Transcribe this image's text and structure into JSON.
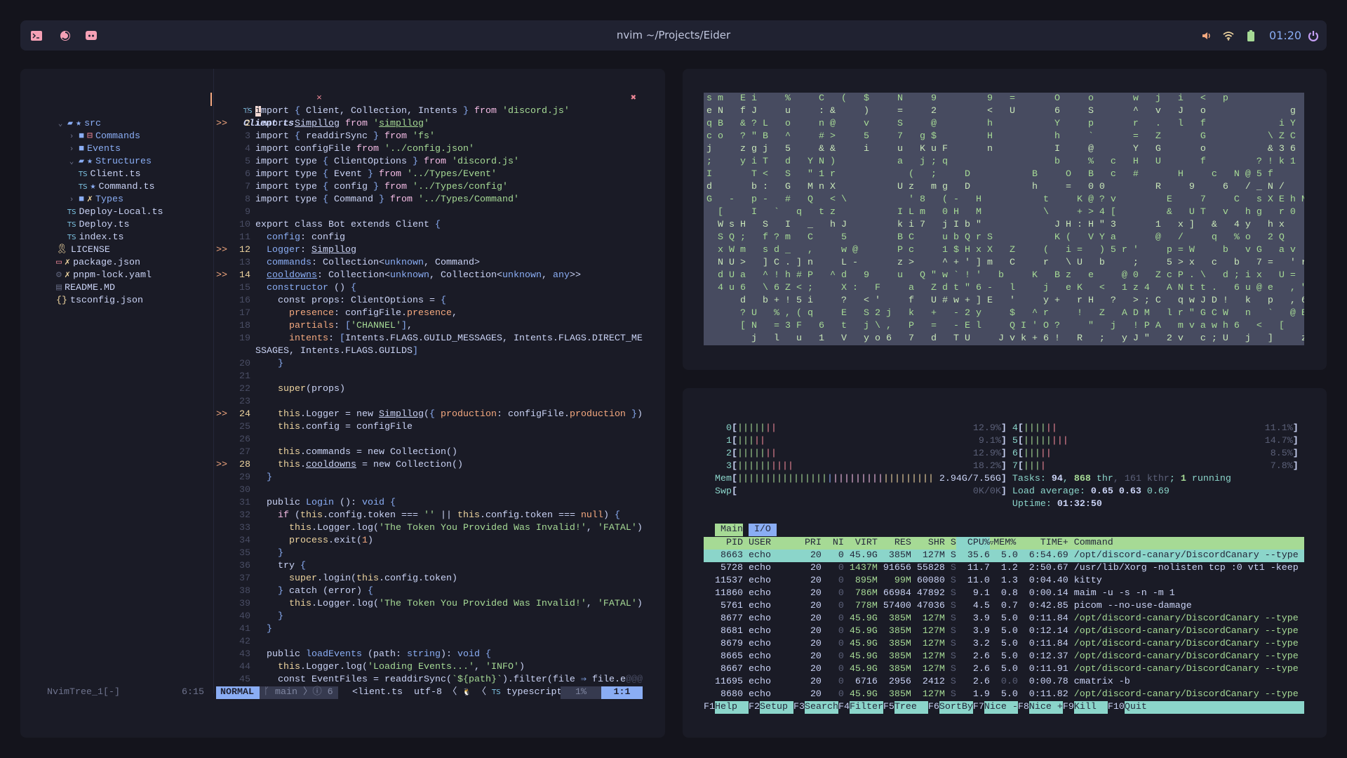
{
  "topbar": {
    "title": "nvim ~/Projects/Eider",
    "clock": "01:20",
    "left_icons": [
      "terminal-icon",
      "firefox-icon",
      "discord-icon"
    ],
    "right_icons": [
      "volume-icon",
      "wifi-icon",
      "battery-icon",
      "power-icon"
    ],
    "colors": {
      "accent": "#f5a0b5",
      "clock": "#8aadf4",
      "volume": "#f5a97f",
      "wifi": "#eed49f",
      "battery": "#a6da95",
      "power": "#c6a0f6"
    }
  },
  "nvim": {
    "tab": {
      "type_label": "TS",
      "filename": "Client.ts",
      "close": "×",
      "close_all": "✖"
    },
    "tree": [
      {
        "name": "src",
        "depth": 0,
        "kind": "dir",
        "open": true,
        "badge": "★"
      },
      {
        "name": "Commands",
        "depth": 1,
        "kind": "dir",
        "open": false,
        "badge": "⊟"
      },
      {
        "name": "Events",
        "depth": 1,
        "kind": "dir",
        "open": false,
        "badge": ""
      },
      {
        "name": "Structures",
        "depth": 1,
        "kind": "dir",
        "open": true,
        "badge": "★"
      },
      {
        "name": "Client.ts",
        "depth": 2,
        "kind": "ts",
        "badge": ""
      },
      {
        "name": "Command.ts",
        "depth": 2,
        "kind": "ts",
        "badge": "★"
      },
      {
        "name": "Types",
        "depth": 1,
        "kind": "dir",
        "open": false,
        "badge": "✗"
      },
      {
        "name": "Deploy-Local.ts",
        "depth": 1,
        "kind": "ts",
        "badge": ""
      },
      {
        "name": "Deploy.ts",
        "depth": 1,
        "kind": "ts",
        "badge": ""
      },
      {
        "name": "index.ts",
        "depth": 1,
        "kind": "ts",
        "badge": ""
      },
      {
        "name": "LICENSE",
        "depth": 0,
        "kind": "license",
        "badge": ""
      },
      {
        "name": "package.json",
        "depth": 0,
        "kind": "package",
        "badge": "✗"
      },
      {
        "name": "pnpm-lock.yaml",
        "depth": 0,
        "kind": "gear",
        "badge": "✗"
      },
      {
        "name": "README.MD",
        "depth": 0,
        "kind": "readme",
        "badge": ""
      },
      {
        "name": "tsconfig.json",
        "depth": 0,
        "kind": "json",
        "badge": ""
      }
    ],
    "sign_text": ">>",
    "signs": [
      2,
      12,
      14,
      24,
      28
    ],
    "code": [
      "import { Client, Collection, Intents } from 'discord.js'",
      "import Simpllog from 'simpllog'",
      "import { readdirSync } from 'fs'",
      "import configFile from '../config.json'",
      "import type { ClientOptions } from 'discord.js'",
      "import type { Event } from '../Types/Event'",
      "import type { config } from '../Types/config'",
      "import type { Command } from '../Types/Command'",
      "",
      "export class Bot extends Client {",
      "  config: config",
      "  Logger: Simpllog",
      "  commands: Collection<unknown, Command>",
      "  cooldowns: Collection<unknown, Collection<unknown, any>>",
      "  constructor () {",
      "    const props: ClientOptions = {",
      "      presence: configFile.presence,",
      "      partials: ['CHANNEL'],",
      "      intents: [Intents.FLAGS.GUILD_MESSAGES, Intents.FLAGS.DIRECT_MESSAGES, Intents.FLAGS.GUILDS]",
      "    }",
      "",
      "    super(props)",
      "",
      "    this.Logger = new Simpllog({ production: configFile.production })",
      "    this.config = configFile",
      "",
      "    this.commands = new Collection()",
      "    this.cooldowns = new Collection()",
      "  }",
      "",
      "  public Login (): void {",
      "    if (this.config.token === '' || this.config.token === null) {",
      "      this.Logger.log('The Token You Provided Was Invalid!', 'FATAL')",
      "      process.exit(1)",
      "    }",
      "    try {",
      "      super.login(this.config.token)",
      "    } catch (error) {",
      "      this.Logger.log('The Token You Provided Was Invalid!', 'FATAL')",
      "    }",
      "  }",
      "",
      "  public loadEvents (path: string): void {",
      "    this.Logger.log('Loading Events...', 'INFO')",
      "    const EventFiles = readdirSync(`${path}`).filter(file ⇒ file.e@@@"
    ],
    "statusline": {
      "tree_name": "NvimTree_1[-]",
      "tree_pos": "6:15",
      "mode": "NORMAL",
      "branch": "main",
      "diagnostics": "ⓘ 6",
      "filename": "<lient.ts",
      "encoding": "utf-8",
      "os_icon": "🐧",
      "filetype_icon": "TS",
      "filetype": "typescript",
      "percent": "1%",
      "position": "1:1"
    }
  },
  "matrix": {
    "rows": [
      "sm Ei  %  C ( $  N  9    9 =   O  o   w j i < p",
      "eN fJ  u  :&  )  =  2    < U   6  S   ^ v J o       g",
      "qB &?L o  n@  v  S  @    h     Y  p   r . l f      iY",
      "co ?\"B ^  #>  5  7 g$    H     h  `   = Z   G     \\ZC",
      "j  zgj 5  &&  i  u KuF   n     I  @   Y G   o     &36",
      ";  yiT d YN)     a j;q         b  % c H U   f    ?!k1",
      "I   T< S \"1r      ( ;  D     B  O B c #   H  c N@5f",
      "d   b: G MnX     Uz mg D     h  = 00    R  9  6 /_N/",
      "G - p- # Q <\\     '8 (- H     t  K@?v    E  7  C sXEhN",
      " [  I ` q tz     ILm 0H M     \\  +>4[    & UT v hg r0",
      " WsH S I _ hJ    ki7 jIb\"      JH:H\"3   1 x] & 4y hx",
      " SQ; f?m C  5    BC  ubQrS     K( VYa   @ /  q %o 2Q",
      " xWm sd_ ,  w@   Pc  1$HxX Z  ( i= )5r'  p=W  b vG av",
      " NU> ]C.]n  L-   z>  ^+']m C  r \\U b  ;  5>x c b 7= 'r",
      " dUa ^!h#P ^d 9  u Q\"w`!' b  K Bz e  @0 ZcP.\\ d;ix U=",
      " 4u6 \\6Z<;  X: F  a Zdt\"6- l  j eK < 1z4 ANtt. 6u@e ,\"",
      "   d b+!5i  ? <'  f U#w+]E '  y+ rH ? >;C qwJD! k p ,6",
      "   ?U %,(q  E S2j k + -2y  $ ^r  ! Z ADM lr\"GCW n ` @E",
      "   [N =3F 6 t j\\, P = -El  QI'O?  \" j !PA mvawh6 < [  C",
      "    j l u 1 V yo6 7 d TU  Jvk+6! R ; yJ\" 2v c;U j ]  z"
    ]
  },
  "htop": {
    "cpus": [
      {
        "id": "0",
        "pct": "12.9%"
      },
      {
        "id": "1",
        "pct": "9.1%"
      },
      {
        "id": "2",
        "pct": "12.9%"
      },
      {
        "id": "3",
        "pct": "18.2%"
      },
      {
        "id": "4",
        "pct": "11.1%"
      },
      {
        "id": "5",
        "pct": "14.7%"
      },
      {
        "id": "6",
        "pct": "8.5%"
      },
      {
        "id": "7",
        "pct": "7.8%"
      }
    ],
    "mem": {
      "label": "Mem",
      "value": "2.94G/7.56G"
    },
    "swap": {
      "label": "Swp",
      "value": "0K/0K"
    },
    "tasks": {
      "label": "Tasks: ",
      "tasks": "94",
      "threads": "868",
      "thr_label": " thr",
      "kthreads": "161 kthr",
      "running": "1",
      "running_label": " running"
    },
    "load": {
      "label": "Load average: ",
      "values": [
        "0.65",
        "0.63",
        "0.69"
      ]
    },
    "uptime": {
      "label": "Uptime: ",
      "value": "01:32:50"
    },
    "tabs": [
      "Main",
      "I/O"
    ],
    "columns": {
      "pid": "PID",
      "user": "USER",
      "pri": "PRI",
      "ni": "NI",
      "virt": "VIRT",
      "res": "RES",
      "shr": "SHR",
      "s": "S",
      "cpu": "CPU%",
      "sort": "▽",
      "mem": "MEM%",
      "time": "TIME+",
      "cmd": "Command"
    },
    "processes": [
      {
        "pid": "8663",
        "user": "echo",
        "pri": "20",
        "ni": "0",
        "virt": "45.9G",
        "res": "385M",
        "shr": "127M",
        "s": "S",
        "cpu": "35.6",
        "mem": "5.0",
        "time": "6:54.69",
        "cmd": "/opt/discord-canary/DiscordCanary --type",
        "selected": true
      },
      {
        "pid": "5728",
        "user": "echo",
        "pri": "20",
        "ni": "0",
        "virt": "1437M",
        "res": "91656",
        "shr": "55828",
        "s": "S",
        "cpu": "11.7",
        "mem": "1.2",
        "time": "2:50.67",
        "cmd": "/usr/lib/Xorg -nolisten tcp :0 vt1 -keep"
      },
      {
        "pid": "11537",
        "user": "echo",
        "pri": "20",
        "ni": "0",
        "virt": "895M",
        "res": "99M",
        "shr": "60080",
        "s": "S",
        "cpu": "11.0",
        "mem": "1.3",
        "time": "0:04.40",
        "cmd": "kitty"
      },
      {
        "pid": "11860",
        "user": "echo",
        "pri": "20",
        "ni": "0",
        "virt": "786M",
        "res": "66984",
        "shr": "47892",
        "s": "S",
        "cpu": "9.1",
        "mem": "0.8",
        "time": "0:00.14",
        "cmd": "maim -u -s -n -m 1"
      },
      {
        "pid": "5761",
        "user": "echo",
        "pri": "20",
        "ni": "0",
        "virt": "778M",
        "res": "57400",
        "shr": "47036",
        "s": "S",
        "cpu": "4.5",
        "mem": "0.7",
        "time": "0:42.85",
        "cmd": "picom --no-use-damage"
      },
      {
        "pid": "8677",
        "user": "echo",
        "pri": "20",
        "ni": "0",
        "virt": "45.9G",
        "res": "385M",
        "shr": "127M",
        "s": "S",
        "cpu": "3.9",
        "mem": "5.0",
        "time": "0:11.84",
        "cmd": "/opt/discord-canary/DiscordCanary --type",
        "thread": true
      },
      {
        "pid": "8681",
        "user": "echo",
        "pri": "20",
        "ni": "0",
        "virt": "45.9G",
        "res": "385M",
        "shr": "127M",
        "s": "S",
        "cpu": "3.9",
        "mem": "5.0",
        "time": "0:12.14",
        "cmd": "/opt/discord-canary/DiscordCanary --type",
        "thread": true
      },
      {
        "pid": "8679",
        "user": "echo",
        "pri": "20",
        "ni": "0",
        "virt": "45.9G",
        "res": "385M",
        "shr": "127M",
        "s": "S",
        "cpu": "3.2",
        "mem": "5.0",
        "time": "0:11.84",
        "cmd": "/opt/discord-canary/DiscordCanary --type",
        "thread": true
      },
      {
        "pid": "8665",
        "user": "echo",
        "pri": "20",
        "ni": "0",
        "virt": "45.9G",
        "res": "385M",
        "shr": "127M",
        "s": "S",
        "cpu": "2.6",
        "mem": "5.0",
        "time": "0:12.37",
        "cmd": "/opt/discord-canary/DiscordCanary --type",
        "thread": true
      },
      {
        "pid": "8667",
        "user": "echo",
        "pri": "20",
        "ni": "0",
        "virt": "45.9G",
        "res": "385M",
        "shr": "127M",
        "s": "S",
        "cpu": "2.6",
        "mem": "5.0",
        "time": "0:11.91",
        "cmd": "/opt/discord-canary/DiscordCanary --type",
        "thread": true
      },
      {
        "pid": "11695",
        "user": "echo",
        "pri": "20",
        "ni": "0",
        "virt": "6716",
        "res": "2956",
        "shr": "2412",
        "s": "S",
        "cpu": "2.6",
        "mem": "0.0",
        "time": "0:00.78",
        "cmd": "cmatrix -b"
      },
      {
        "pid": "8680",
        "user": "echo",
        "pri": "20",
        "ni": "0",
        "virt": "45.9G",
        "res": "385M",
        "shr": "127M",
        "s": "S",
        "cpu": "1.9",
        "mem": "5.0",
        "time": "0:11.82",
        "cmd": "/opt/discord-canary/DiscordCanary --type",
        "thread": true
      }
    ],
    "footer": [
      {
        "key": "F1",
        "label": "Help"
      },
      {
        "key": "F2",
        "label": "Setup"
      },
      {
        "key": "F3",
        "label": "Search"
      },
      {
        "key": "F4",
        "label": "Filter"
      },
      {
        "key": "F5",
        "label": "Tree"
      },
      {
        "key": "F6",
        "label": "SortBy"
      },
      {
        "key": "F7",
        "label": "Nice -"
      },
      {
        "key": "F8",
        "label": "Nice +"
      },
      {
        "key": "F9",
        "label": "Kill"
      },
      {
        "key": "F10",
        "label": "Quit"
      }
    ],
    "colors": {
      "header": "#a6da95",
      "selected": "#8bd5ca",
      "io_tab": "#8aadf4"
    }
  }
}
